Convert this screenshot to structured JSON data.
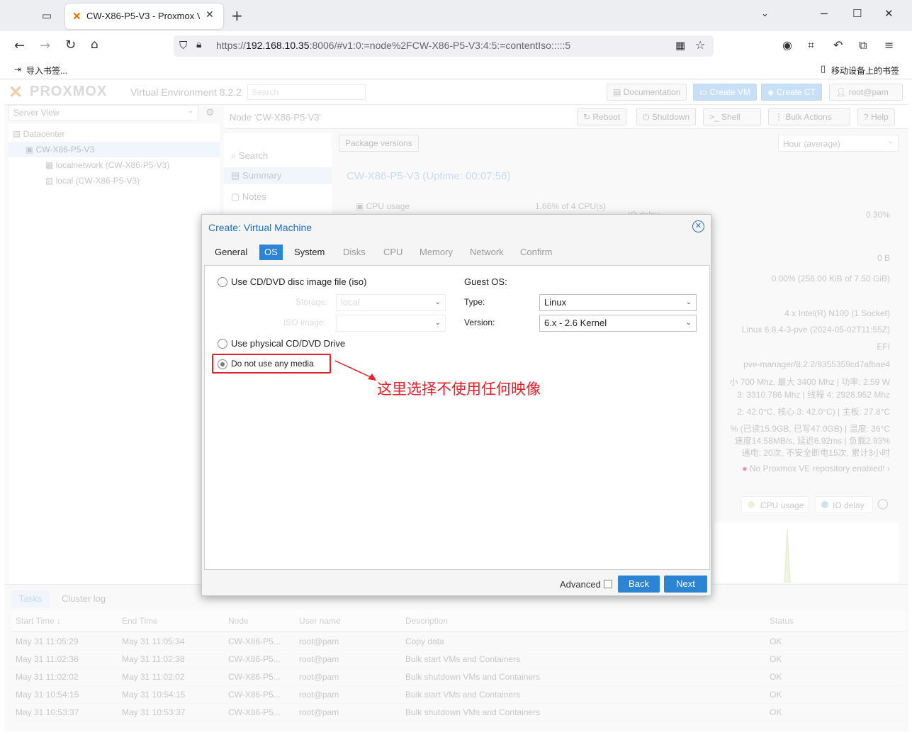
{
  "browser": {
    "tab_title": "CW-X86-P5-V3 - Proxmox Vi",
    "new_tab_symbol": "+",
    "url_prefix": "https://",
    "url_host": "192.168.10.35",
    "url_rest": ":8006/#v1:0:=node%2FCW-X86-P5-V3:4:5:=contentIso:::::5",
    "bookmark_left": "导入书签...",
    "bookmark_right": "移动设备上的书签"
  },
  "pve": {
    "logo_text": "PROXMOX",
    "product": "Virtual Environment 8.2.2",
    "search_placeholder": "Search",
    "header_buttons": {
      "docs": "Documentation",
      "create_vm": "Create VM",
      "create_ct": "Create CT",
      "user": "root@pam"
    },
    "server_view": "Server View",
    "tree": {
      "datacenter": "Datacenter",
      "node": "CW-X86-P5-V3",
      "storage1": "localnetwork (CW-X86-P5-V3)",
      "storage2": "local (CW-X86-P5-V3)"
    },
    "node_title": "Node 'CW-X86-P5-V3'",
    "node_buttons": {
      "reboot": "Reboot",
      "shutdown": "Shutdown",
      "shell": "Shell",
      "bulk": "Bulk Actions",
      "help": "Help"
    },
    "menu": {
      "search": "Search",
      "summary": "Summary",
      "notes": "Notes"
    },
    "package_versions": "Package versions",
    "timeframe": "Hour (average)",
    "uptime": "CW-X86-P5-V3 (Uptime: 00:07:56)",
    "cpu_usage_label": "CPU usage",
    "cpu_usage_value": "1.66% of 4 CPU(s)",
    "io_delay_label": "IO delay",
    "io_delay_value": "0.30%",
    "right_values": [
      "0 B",
      "0.00% (256.00 KiB of 7.50 GiB)",
      "4 x Intel(R) N100 (1 Socket)",
      "Linux 6.8.4-3-pve (2024-05-02T11:55Z)",
      "EFI",
      "pve-manager/8.2.2/9355359cd7afbae4",
      "小 700 Mhz, 最大 3400 Mhz | 功率: 2.59 W",
      "3: 3310.786 Mhz | 线程 4: 2928.952 Mhz",
      "2: 42.0°C, 核心 3: 42.0°C) | 主板: 27.8°C",
      "% (已读15.9GB, 已写47.0GB) | 温度: 36°C",
      "速度14.58MB/s, 延迟6.92ms | 负载2.93%",
      "通电: 20次, 不安全断电15次, 累计3小时"
    ],
    "repo_warning": "No Proxmox VE repository enabled!",
    "legend": {
      "cpu": "CPU usage",
      "io": "IO delay"
    },
    "bottom_tabs": {
      "tasks": "Tasks",
      "cluster": "Cluster log"
    },
    "task_columns": [
      "Start Time ↓",
      "End Time",
      "Node",
      "User name",
      "Description",
      "Status"
    ],
    "tasks": [
      [
        "May 31 11:05:29",
        "May 31 11:05:34",
        "CW-X86-P5...",
        "root@pam",
        "Copy data",
        "OK"
      ],
      [
        "May 31 11:02:38",
        "May 31 11:02:38",
        "CW-X86-P5...",
        "root@pam",
        "Bulk start VMs and Containers",
        "OK"
      ],
      [
        "May 31 11:02:02",
        "May 31 11:02:02",
        "CW-X86-P5...",
        "root@pam",
        "Bulk shutdown VMs and Containers",
        "OK"
      ],
      [
        "May 31 10:54:15",
        "May 31 10:54:15",
        "CW-X86-P5...",
        "root@pam",
        "Bulk start VMs and Containers",
        "OK"
      ],
      [
        "May 31 10:53:37",
        "May 31 10:53:37",
        "CW-X86-P5...",
        "root@pam",
        "Bulk shutdown VMs and Containers",
        "OK"
      ]
    ]
  },
  "dialog": {
    "title": "Create: Virtual Machine",
    "tabs": [
      "General",
      "OS",
      "System",
      "Disks",
      "CPU",
      "Memory",
      "Network",
      "Confirm"
    ],
    "active_tab": "OS",
    "opt_iso": "Use CD/DVD disc image file (iso)",
    "storage_label": "Storage:",
    "storage_value": "local",
    "iso_label": "ISO image:",
    "opt_physical": "Use physical CD/DVD Drive",
    "opt_none": "Do not use any media",
    "selected_option": "Do not use any media",
    "guest_os": "Guest OS:",
    "type_label": "Type:",
    "type_value": "Linux",
    "version_label": "Version:",
    "version_value": "6.x - 2.6 Kernel",
    "advanced": "Advanced",
    "back": "Back",
    "next": "Next"
  },
  "annotation": {
    "text": "这里选择不使用任何映像",
    "color": "#e8202a"
  }
}
